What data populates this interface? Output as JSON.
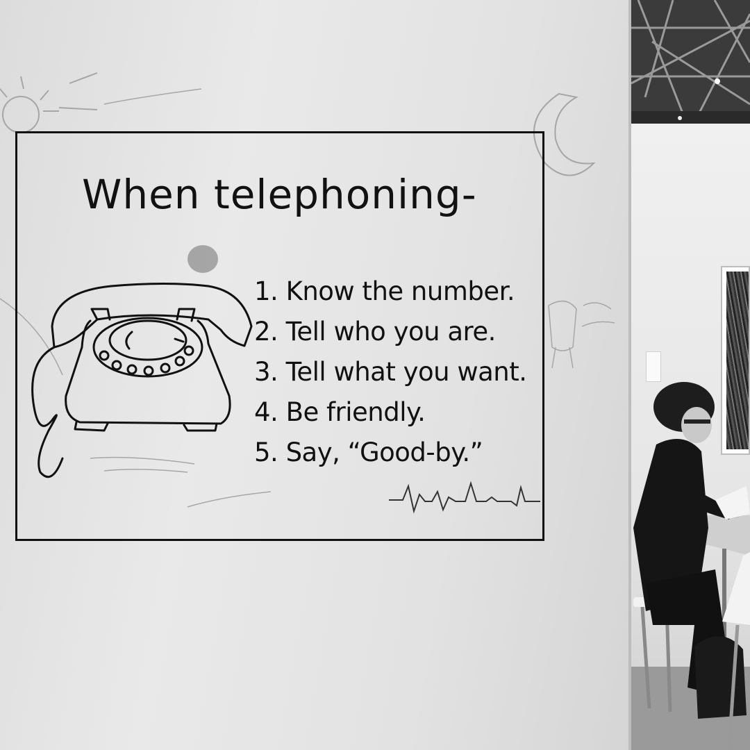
{
  "sign": {
    "title": "When telephoning-",
    "rules": [
      "1. Know the number.",
      "2. Tell who you are.",
      "3. Tell what you want.",
      "4. Be friendly.",
      "5. Say, “Good-by.”"
    ]
  },
  "colors": {
    "ink": "#111111",
    "wall": "#e4e4e4",
    "pencil": "#9a9a9a"
  },
  "icons": {
    "telephone": "rotary-telephone-drawing",
    "heartbeat": "heartbeat-line-doodle",
    "moon": "crescent-moon-doodle",
    "sun": "sun-doodle"
  }
}
